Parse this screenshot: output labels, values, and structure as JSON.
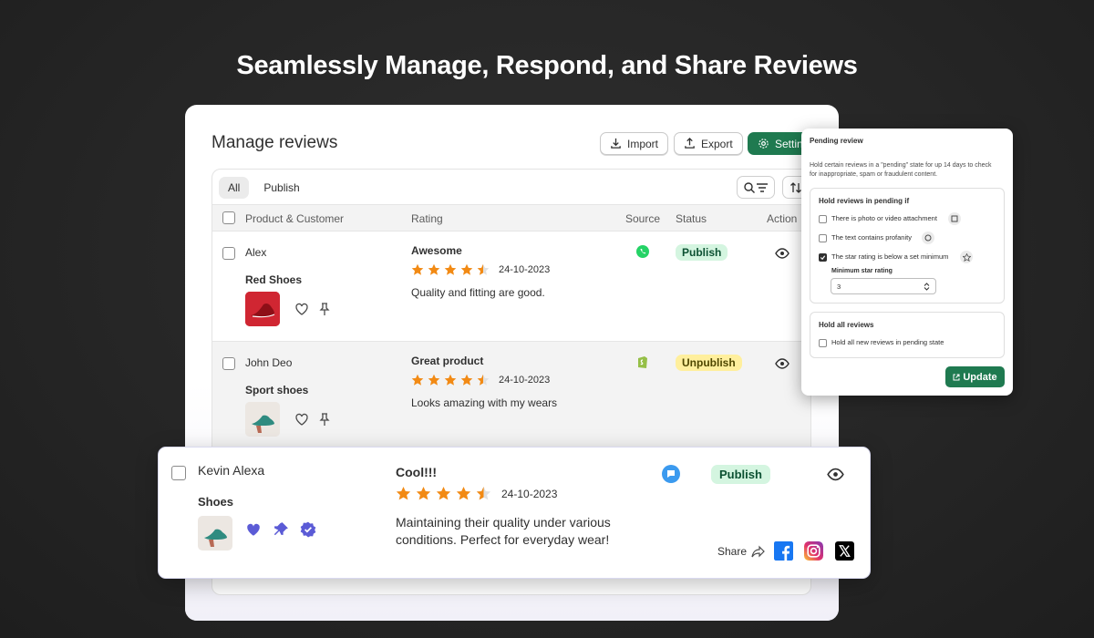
{
  "headline": "Seamlessly Manage, Respond, and Share Reviews",
  "page_title": "Manage reviews",
  "buttons": {
    "import": "Import",
    "export": "Export",
    "settings": "Settin"
  },
  "tabs": [
    {
      "label": "All",
      "active": true
    },
    {
      "label": "Publish",
      "active": false
    }
  ],
  "columns": {
    "product": "Product & Customer",
    "rating": "Rating",
    "source": "Source",
    "status": "Status",
    "action": "Action"
  },
  "reviews": [
    {
      "customer": "Alex",
      "product": "Red Shoes",
      "title": "Awesome",
      "rating": 4.5,
      "date": "24-10-2023",
      "text": "Quality and fitting are good.",
      "source": "whatsapp-icon",
      "status": "Publish"
    },
    {
      "customer": "John Deo",
      "product": "Sport shoes",
      "title": "Great product",
      "rating": 4.5,
      "date": "24-10-2023",
      "text": "Looks amazing with my wears",
      "source": "shopify-icon",
      "status": "Unpublish"
    }
  ],
  "featured_review": {
    "customer": "Kevin Alexa",
    "product": "Shoes",
    "title": "Cool!!!",
    "rating": 4.5,
    "date": "24-10-2023",
    "text_line1": "Maintaining their quality under various",
    "text_line2": "conditions. Perfect for everyday wear!",
    "source": "chat-icon",
    "status": "Publish",
    "share_label": "Share"
  },
  "pending_popup": {
    "title": "Pending review",
    "description_line1": "Hold certain reviews in a \"pending\" state for up 14 days to check",
    "description_line2": "for inappropriate, spam or fraudulent content.",
    "hold_if_heading": "Hold reviews in pending if",
    "options": [
      {
        "label": "There is photo or video attachment",
        "checked": false
      },
      {
        "label": "The text contains profanity",
        "checked": false
      },
      {
        "label": "The star rating is below a set minimum",
        "checked": true
      }
    ],
    "min_rating_label": "Minimum star rating",
    "min_rating_value": "3",
    "hold_all_heading": "Hold all reviews",
    "hold_all_option": "Hold all new reviews in pending state",
    "hold_all_checked": false,
    "update_button": "Update"
  },
  "colors": {
    "accent": "#1f7a50",
    "star": "#f28a14",
    "publish_bg": "#d4f5e0",
    "unpublish_bg": "#ffef9d",
    "purple": "#5b5bd6"
  }
}
